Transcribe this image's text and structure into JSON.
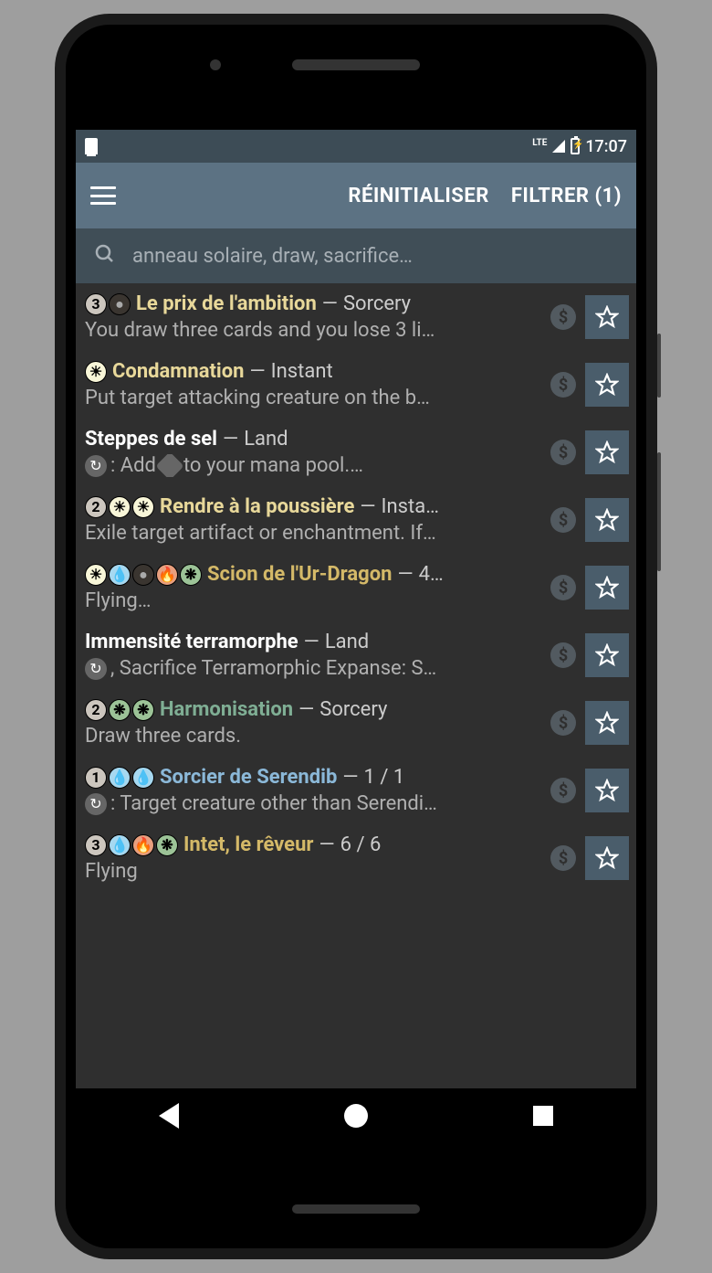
{
  "status": {
    "time": "17:07",
    "lte": "LTE"
  },
  "appbar": {
    "reset": "RÉINITIALISER",
    "filter": "FILTRER (1)"
  },
  "search": {
    "placeholder": "anneau solaire, draw, sacrifice…"
  },
  "mana_colors": {
    "n": "mc-n",
    "w": "mc-w",
    "u": "mc-u",
    "b": "mc-b",
    "r": "mc-r",
    "g": "mc-g"
  },
  "cards": [
    {
      "cost": [
        {
          "t": "n",
          "v": "3"
        },
        {
          "t": "b",
          "v": "●"
        }
      ],
      "name": "Le prix de l'ambition",
      "name_class": "nc-white",
      "type": "Sorcery",
      "text": "You draw three cards and you lose 3 li…",
      "has_tap": false
    },
    {
      "cost": [
        {
          "t": "w",
          "v": "☀"
        }
      ],
      "name": "Condamnation",
      "name_class": "nc-white",
      "type": "Instant",
      "text": "Put target attacking creature on the b…",
      "has_tap": false
    },
    {
      "cost": [],
      "name": "Steppes de sel",
      "name_class": "nc-default",
      "type": "Land",
      "text_pre_tap": true,
      "text": ": Add ",
      "text_after_diamond": " to your mana pool.…",
      "has_tap": true,
      "has_diamond": true
    },
    {
      "cost": [
        {
          "t": "n",
          "v": "2"
        },
        {
          "t": "w",
          "v": "☀"
        },
        {
          "t": "w",
          "v": "☀"
        }
      ],
      "name": "Rendre à la poussière",
      "name_class": "nc-white",
      "type": "Insta…",
      "text": "Exile target artifact or enchantment. If…",
      "has_tap": false
    },
    {
      "cost": [
        {
          "t": "w",
          "v": "☀"
        },
        {
          "t": "u",
          "v": "💧"
        },
        {
          "t": "b",
          "v": "●"
        },
        {
          "t": "r",
          "v": "🔥"
        },
        {
          "t": "g",
          "v": "❋"
        }
      ],
      "name": "Scion de l'Ur-Dragon",
      "name_class": "nc-gold",
      "type": "4…",
      "text": "Flying…",
      "has_tap": false
    },
    {
      "cost": [],
      "name": "Immensité terramorphe",
      "name_class": "nc-default",
      "type": "Land",
      "text": ", Sacrifice Terramorphic Expanse: S…",
      "has_tap": true
    },
    {
      "cost": [
        {
          "t": "n",
          "v": "2"
        },
        {
          "t": "g",
          "v": "❋"
        },
        {
          "t": "g",
          "v": "❋"
        }
      ],
      "name": "Harmonisation",
      "name_class": "nc-green",
      "type": "Sorcery",
      "text": "Draw three cards.",
      "has_tap": false
    },
    {
      "cost": [
        {
          "t": "n",
          "v": "1"
        },
        {
          "t": "u",
          "v": "💧"
        },
        {
          "t": "u",
          "v": "💧"
        }
      ],
      "name": "Sorcier de Serendib",
      "name_class": "nc-blue",
      "type": "1 / 1",
      "text": ": Target creature other than Serendi…",
      "has_tap": true
    },
    {
      "cost": [
        {
          "t": "n",
          "v": "3"
        },
        {
          "t": "u",
          "v": "💧"
        },
        {
          "t": "r",
          "v": "🔥"
        },
        {
          "t": "g",
          "v": "❋"
        }
      ],
      "name": "Intet, le rêveur",
      "name_class": "nc-gold",
      "type": "6 / 6",
      "text": "Flying",
      "has_tap": false,
      "partial": true
    }
  ]
}
